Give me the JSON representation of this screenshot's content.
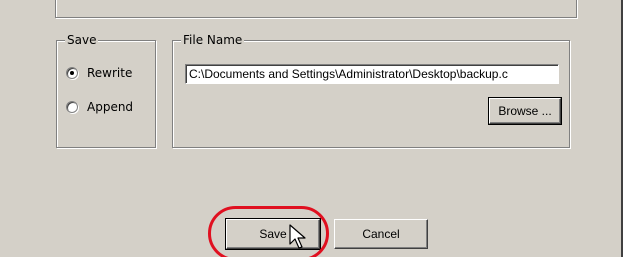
{
  "save_group": {
    "title": "Save",
    "options": [
      {
        "label": "Rewrite",
        "checked": true
      },
      {
        "label": "Append",
        "checked": false
      }
    ]
  },
  "file_group": {
    "title": "File Name",
    "path_value": "C:\\Documents and Settings\\Administrator\\Desktop\\backup.c",
    "browse_label": "Browse ..."
  },
  "buttons": {
    "save_label": "Save",
    "cancel_label": "Cancel"
  },
  "annotation": {
    "highlight_color": "#e01020",
    "cursor_icon": "arrow-cursor-icon"
  }
}
